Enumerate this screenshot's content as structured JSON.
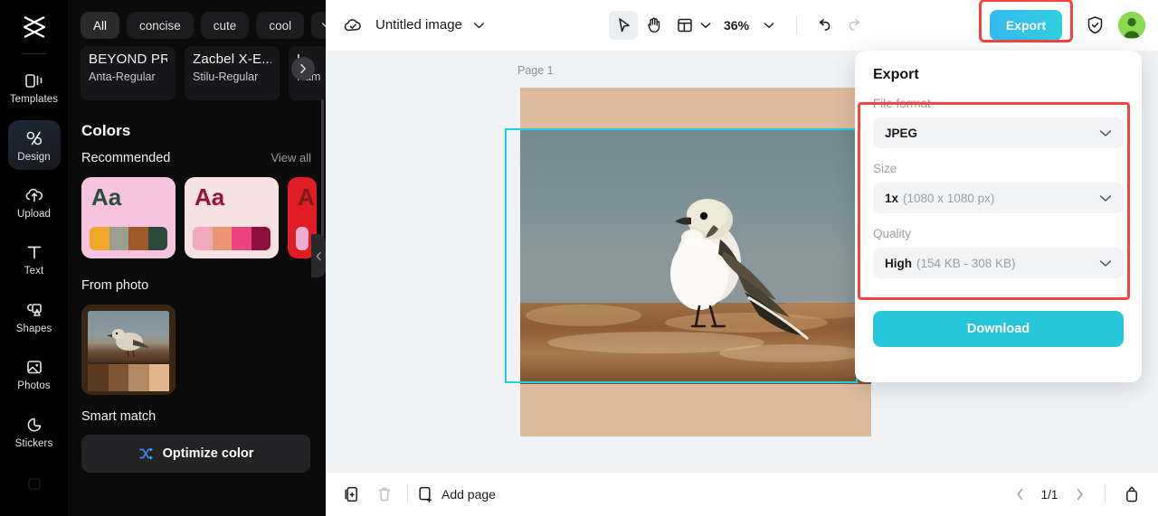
{
  "rail": {
    "logo_icon": "capcut-logo-icon",
    "items": [
      {
        "id": "templates",
        "label": "Templates",
        "icon": "templates-icon",
        "active": false
      },
      {
        "id": "design",
        "label": "Design",
        "icon": "design-brush-icon",
        "active": true
      },
      {
        "id": "upload",
        "label": "Upload",
        "icon": "upload-cloud-icon",
        "active": false
      },
      {
        "id": "text",
        "label": "Text",
        "icon": "text-t-icon",
        "active": false
      },
      {
        "id": "shapes",
        "label": "Shapes",
        "icon": "shapes-icon",
        "active": false
      },
      {
        "id": "photos",
        "label": "Photos",
        "icon": "photo-icon",
        "active": false
      },
      {
        "id": "stickers",
        "label": "Stickers",
        "icon": "sticker-icon",
        "active": false
      }
    ]
  },
  "panel": {
    "chips": [
      {
        "label": "All",
        "selected": true
      },
      {
        "label": "concise",
        "selected": false
      },
      {
        "label": "cute",
        "selected": false
      },
      {
        "label": "cool",
        "selected": false
      }
    ],
    "chip_more_icon": "chevron-down-icon",
    "font_cards": [
      {
        "sample": "BEYOND PRO...",
        "name": "Anta-Regular"
      },
      {
        "sample": "Zacbel X-E...",
        "name": "Stilu-Regular"
      },
      {
        "sample": "L",
        "name": "Ham"
      }
    ],
    "font_next_icon": "chevron-right-icon",
    "colors_title": "Colors",
    "recommended_label": "Recommended",
    "view_all_label": "View all",
    "palette_next_icon": "chevron-right-icon",
    "palettes": [
      {
        "bg": "#f7c4e0",
        "aa": "Aa",
        "aa_color": "#2b4d3c",
        "strip": [
          "#f0a627",
          "#9aa08f",
          "#a0592b",
          "#2c4a3a"
        ]
      },
      {
        "bg": "#f6e2e2",
        "aa": "Aa",
        "aa_color": "#9b1238",
        "strip": [
          "#f0a9b8",
          "#ea9674",
          "#ef4381",
          "#8e0f3c"
        ]
      },
      {
        "bg": "#e01c24",
        "aa": "A",
        "aa_color": "#7d1a1a",
        "strip": [
          "#ebaed2"
        ]
      }
    ],
    "from_photo_label": "From photo",
    "from_photo_strip": [
      "#5b3a20",
      "#7d5636",
      "#b38862",
      "#e2b58d"
    ],
    "smart_match_label": "Smart match",
    "optimize_label": "Optimize color",
    "optimize_icon": "shuffle-icon"
  },
  "topbar": {
    "cloud_icon": "cloud-save-icon",
    "doc_title": "Untitled image",
    "title_caret_icon": "chevron-down-icon",
    "tools": [
      {
        "id": "select",
        "icon": "cursor-arrow-icon",
        "active": true
      },
      {
        "id": "hand",
        "icon": "hand-icon",
        "active": false
      },
      {
        "id": "layout",
        "icon": "layout-panel-icon",
        "active": false,
        "caret": "chevron-down-icon"
      }
    ],
    "zoom_value": "36%",
    "zoom_caret_icon": "chevron-down-icon",
    "undo_icon": "undo-icon",
    "redo_icon": "redo-icon",
    "export_label": "Export",
    "shield_icon": "shield-check-icon",
    "avatar_icon": "user-avatar",
    "export_highlight_color": "#f4443c",
    "export_accent_color": "#2ecfe0"
  },
  "canvas": {
    "page_label": "Page 1",
    "page_bg": "#debb9c",
    "selection_color": "#22d0e8"
  },
  "export_panel": {
    "title": "Export",
    "fields": [
      {
        "id": "file-format",
        "label": "File format",
        "value": "JPEG",
        "sub": "",
        "caret": "chevron-down-icon"
      },
      {
        "id": "size",
        "label": "Size",
        "value": "1x",
        "sub": "(1080 x 1080 px)",
        "caret": "chevron-down-icon"
      },
      {
        "id": "quality",
        "label": "Quality",
        "value": "High",
        "sub": "(154 KB - 308 KB)",
        "caret": "chevron-down-icon"
      }
    ],
    "download_label": "Download",
    "highlight_color": "#f4443c",
    "download_color": "#26c6da"
  },
  "bottombar": {
    "duplicate_icon": "duplicate-page-icon",
    "delete_icon": "trash-icon",
    "add_page_label": "Add page",
    "add_page_icon": "add-page-icon",
    "prev_icon": "chevron-left-icon",
    "page_indicator": "1/1",
    "next_icon": "chevron-right-icon",
    "expand_icon": "expand-up-icon"
  }
}
